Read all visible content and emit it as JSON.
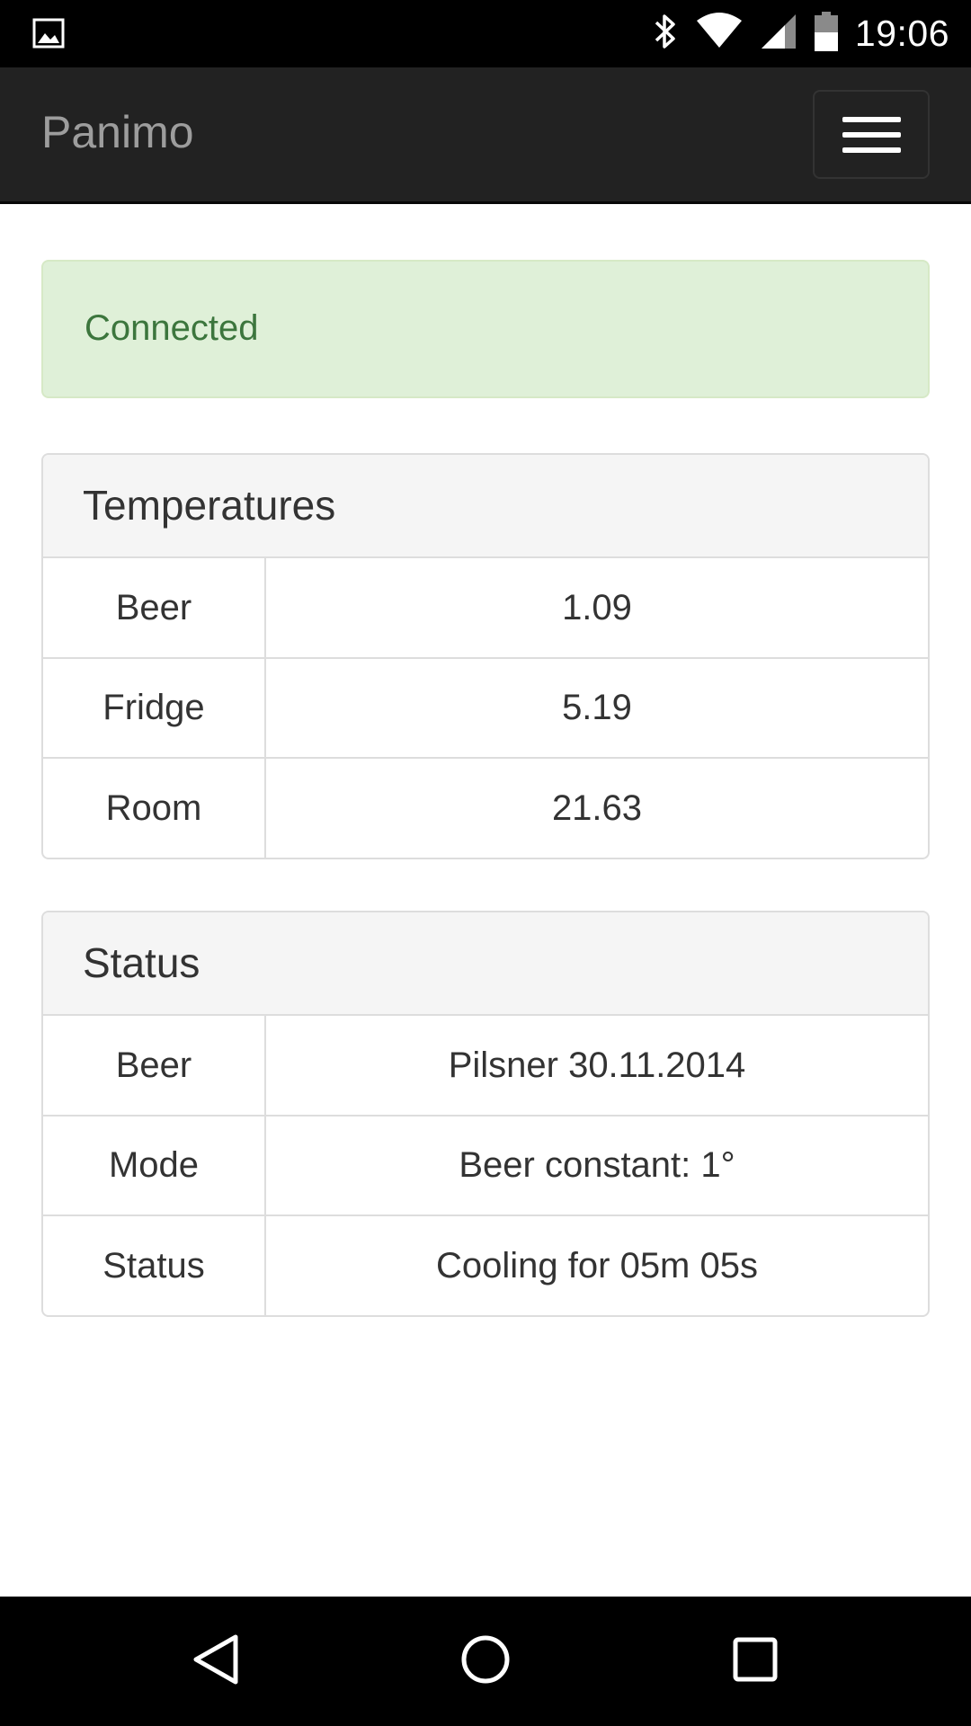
{
  "status_bar": {
    "time": "19:06",
    "icons": [
      "image-icon",
      "bluetooth-icon",
      "wifi-icon",
      "cell-signal-icon",
      "battery-icon"
    ]
  },
  "navbar": {
    "brand": "Panimo",
    "menu_icon": "hamburger-menu-icon"
  },
  "alert": {
    "text": "Connected",
    "color": "#3c763d",
    "background": "#dff0d8"
  },
  "temperatures": {
    "heading": "Temperatures",
    "rows": [
      {
        "label": "Beer",
        "value": "1.09"
      },
      {
        "label": "Fridge",
        "value": "5.19"
      },
      {
        "label": "Room",
        "value": "21.63"
      }
    ]
  },
  "status": {
    "heading": "Status",
    "rows": [
      {
        "label": "Beer",
        "value": "Pilsner 30.11.2014"
      },
      {
        "label": "Mode",
        "value": "Beer constant: 1°"
      },
      {
        "label": "Status",
        "value": "Cooling for 05m 05s"
      }
    ]
  },
  "android_nav": {
    "icons": [
      "back-icon",
      "home-icon",
      "recents-icon"
    ]
  }
}
